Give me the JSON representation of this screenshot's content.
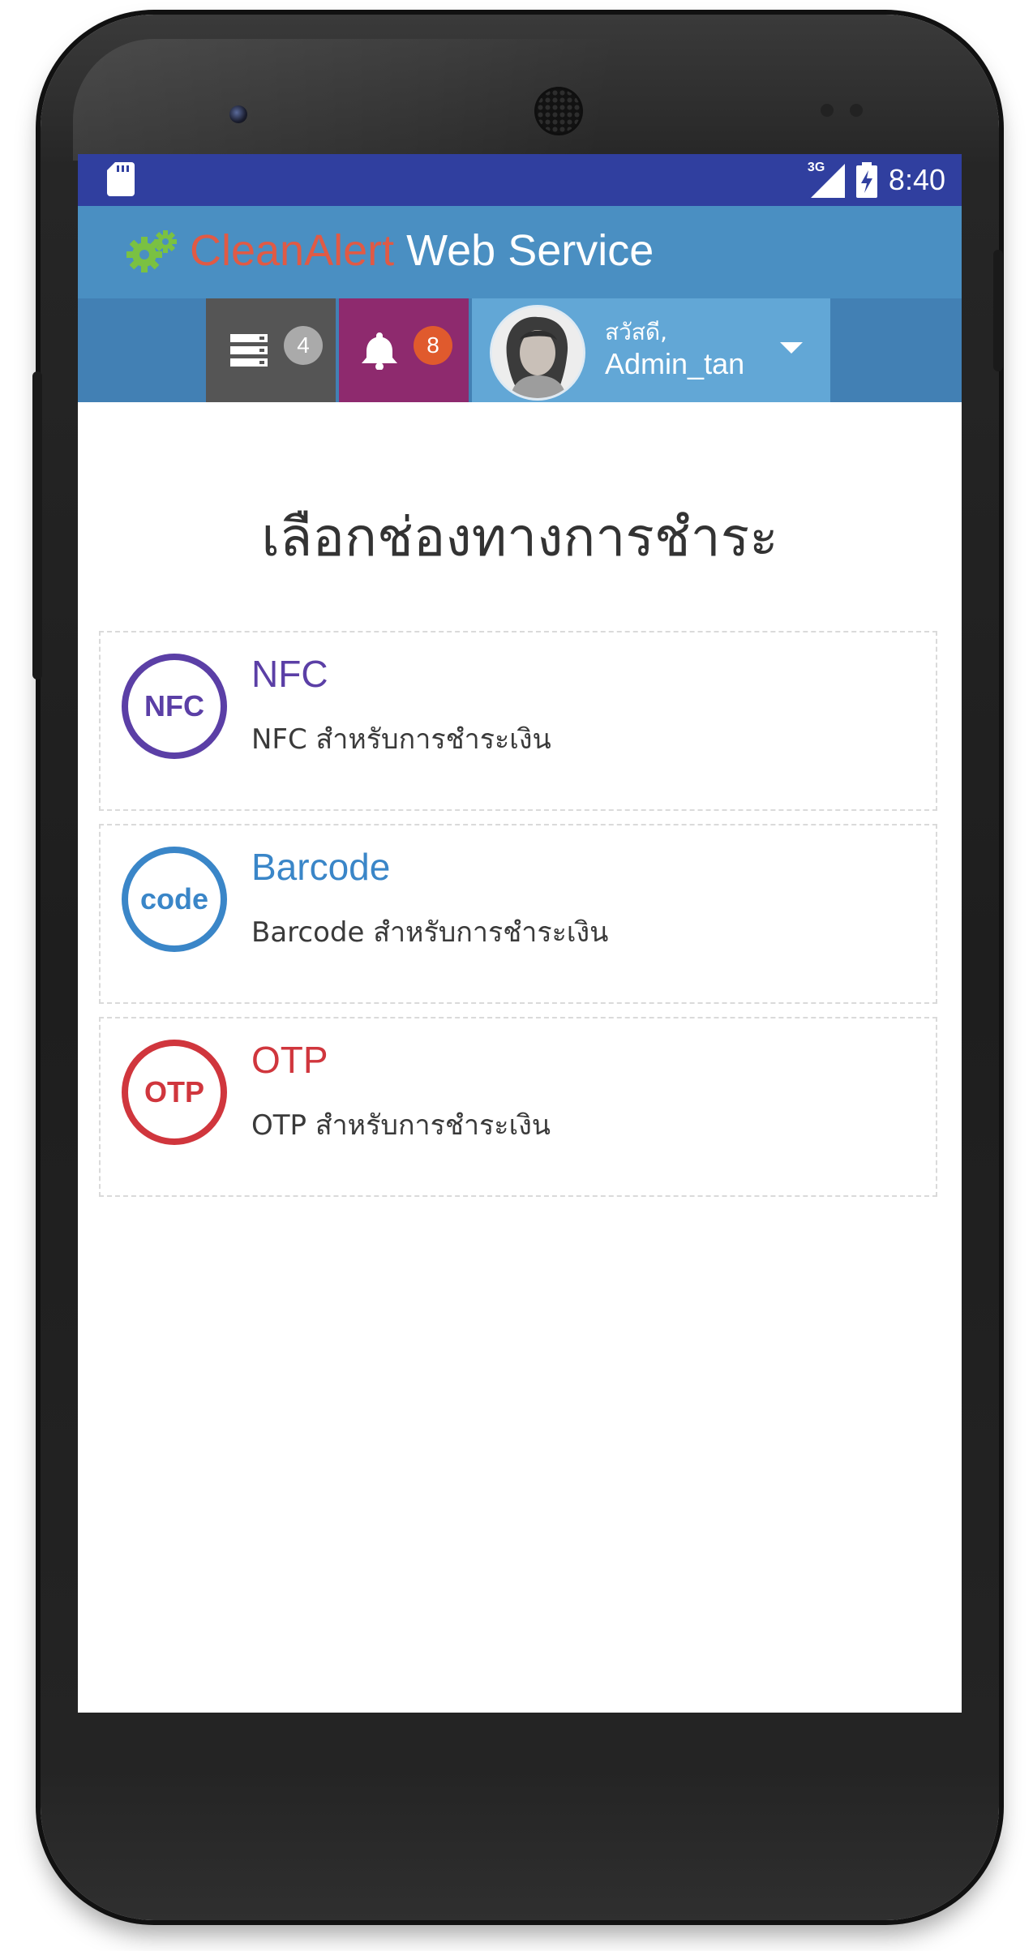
{
  "status_bar": {
    "network": "3G",
    "time": "8:40"
  },
  "header": {
    "brand_part1": "CleanAlert",
    "brand_part2": "Web Service",
    "servers_badge": "4",
    "notifications_badge": "8",
    "greeting": "สวัสดี,",
    "username": "Admin_tan"
  },
  "main": {
    "title": "เลือกช่องทางการชำระ",
    "options": [
      {
        "icon_text": "NFC",
        "title": "NFC",
        "description": "NFC สำหรับการชำระเงิน",
        "color": "#5b3fa6"
      },
      {
        "icon_text": "code",
        "title": "Barcode",
        "description": "Barcode สำหรับการชำระเงิน",
        "color": "#3a86c8"
      },
      {
        "icon_text": "OTP",
        "title": "OTP",
        "description": "OTP สำหรับการชำระเงิน",
        "color": "#d0363d"
      }
    ]
  },
  "colors": {
    "status_bar": "#303f9f",
    "brand_bar": "#4a8fc2",
    "nav_bar": "#4280b4",
    "servers_tile": "#555555",
    "bell_tile": "#8e2a6e",
    "user_tile": "#62a7d6",
    "brand_accent": "#e05a45"
  }
}
